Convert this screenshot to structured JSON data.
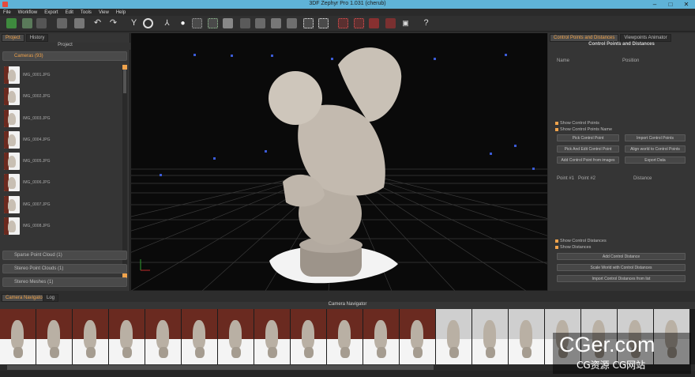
{
  "window": {
    "title": "3DF Zephyr Pro 1.031 (cherub)"
  },
  "menu": [
    "File",
    "Workflow",
    "Export",
    "Edit",
    "Tools",
    "View",
    "Help"
  ],
  "left": {
    "tabs": [
      "Project",
      "History"
    ],
    "header": "Project",
    "cameras_label": "Cameras (93)",
    "cameras": [
      "IMG_0001.JPG",
      "IMG_0002.JPG",
      "IMG_0003.JPG",
      "IMG_0004.JPG",
      "IMG_0005.JPG",
      "IMG_0006.JPG",
      "IMG_0007.JPG",
      "IMG_0008.JPG"
    ],
    "sections": [
      "Sparse Point Cloud (1)",
      "Stereo Point Clouds (1)",
      "Stereo Meshes (1)"
    ]
  },
  "right": {
    "tabs": [
      "Control Points and Distances",
      "Viewpoints Animator"
    ],
    "header": "Control Points and Distances",
    "cp_columns": [
      "Name",
      "Position"
    ],
    "checks_cp": [
      "Show Control Points",
      "Show Control Points Name"
    ],
    "buttons_cp": [
      "Pick Control Point",
      "Import Control Points",
      "Pick And Edit Control Point",
      "Align world to Control Points",
      "Add Control Point from images",
      "Export Data"
    ],
    "dist_columns": [
      "Point #1",
      "Point #2",
      "Distance"
    ],
    "checks_dist": [
      "Show Control Distances",
      "Show Distances"
    ],
    "buttons_dist": [
      "Add Control Distance",
      "Scale World with Control Distances",
      "Import Control Distances from list"
    ]
  },
  "bottom": {
    "tabs": [
      "Camera Navigator",
      "Log"
    ],
    "navigator_label": "Camera Navigator"
  },
  "watermark": {
    "line1": "CGer.com",
    "line2": "CG资源 CG网站"
  },
  "colors": {
    "accent": "#f0a34c",
    "titlebar": "#5fb3d7",
    "grid": "#2e2e2e"
  }
}
